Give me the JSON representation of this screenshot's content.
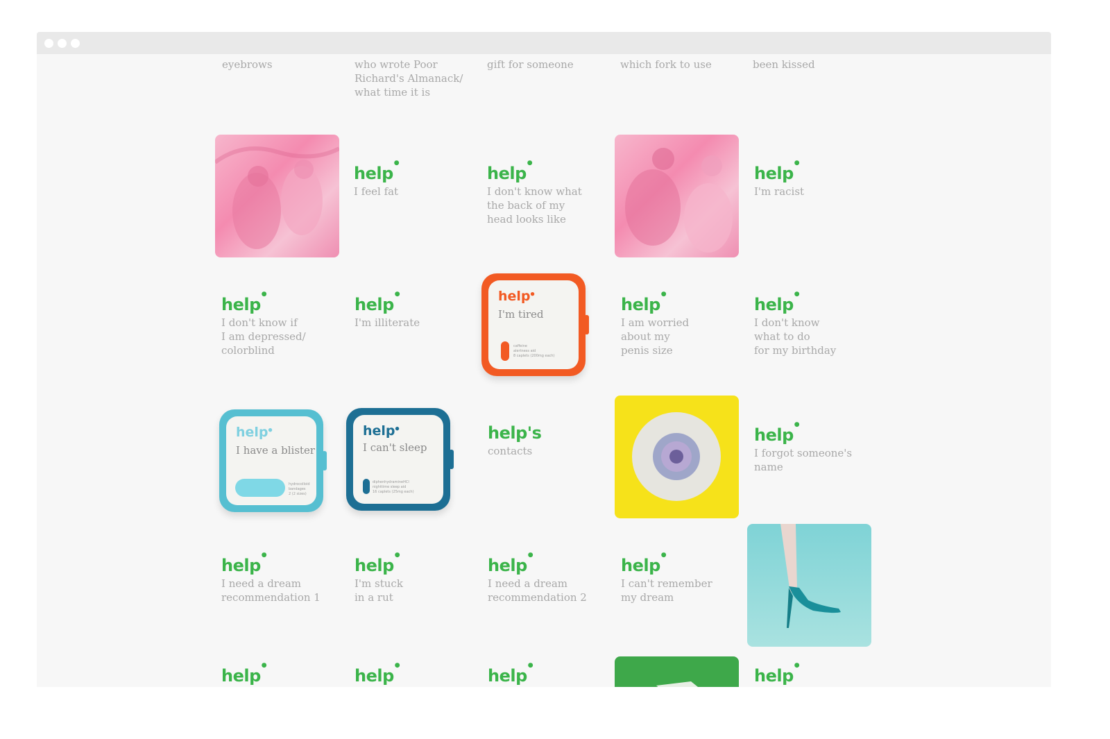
{
  "colors": {
    "brand_green": "#3bb44a",
    "text_gray": "#a8a8a8",
    "orange": "#f25a23",
    "light_blue": "#56bfd1",
    "dark_blue": "#1d6f94"
  },
  "brand": "help",
  "top_row": [
    {
      "text": "eyebrows"
    },
    {
      "text": "who wrote Poor\nRichard's Almanack/\nwhat time it is"
    },
    {
      "text": "gift for someone"
    },
    {
      "text": "which fork to use"
    },
    {
      "text": "been kissed"
    }
  ],
  "items": {
    "fat": "I feel fat",
    "head": "I don't know what\nthe back of my\nhead looks like",
    "racist": "I'm racist",
    "depressed": "I don't know if\nI am depressed/\ncolorblind",
    "illiterate": "I'm illiterate",
    "worried": "I am worried\nabout my\npenis size",
    "birthday": "I don't know\nwhat to do\nfor my birthday",
    "contacts_brand": "help's",
    "contacts": "contacts",
    "forgot": "I forgot someone's\nname",
    "dream1": "I need a dream\nrecommendation 1",
    "stuck": "I'm stuck\nin a rut",
    "dream2": "I need a dream\nrecommendation 2",
    "remember": "I can't remember\nmy dream"
  },
  "packages": {
    "tired": {
      "title": "I'm tired",
      "fine": "caffeine\nalertness aid\n8 caplets (200mg each)"
    },
    "blister": {
      "title": "I have a blister",
      "fine": "hydrocolloid\nbandages\n2 (2 sizes)"
    },
    "sleep": {
      "title": "I can't sleep",
      "fine": "diphenhydramineHCl\nnighttime sleep aid\n16 caplets (25mg each)"
    }
  }
}
